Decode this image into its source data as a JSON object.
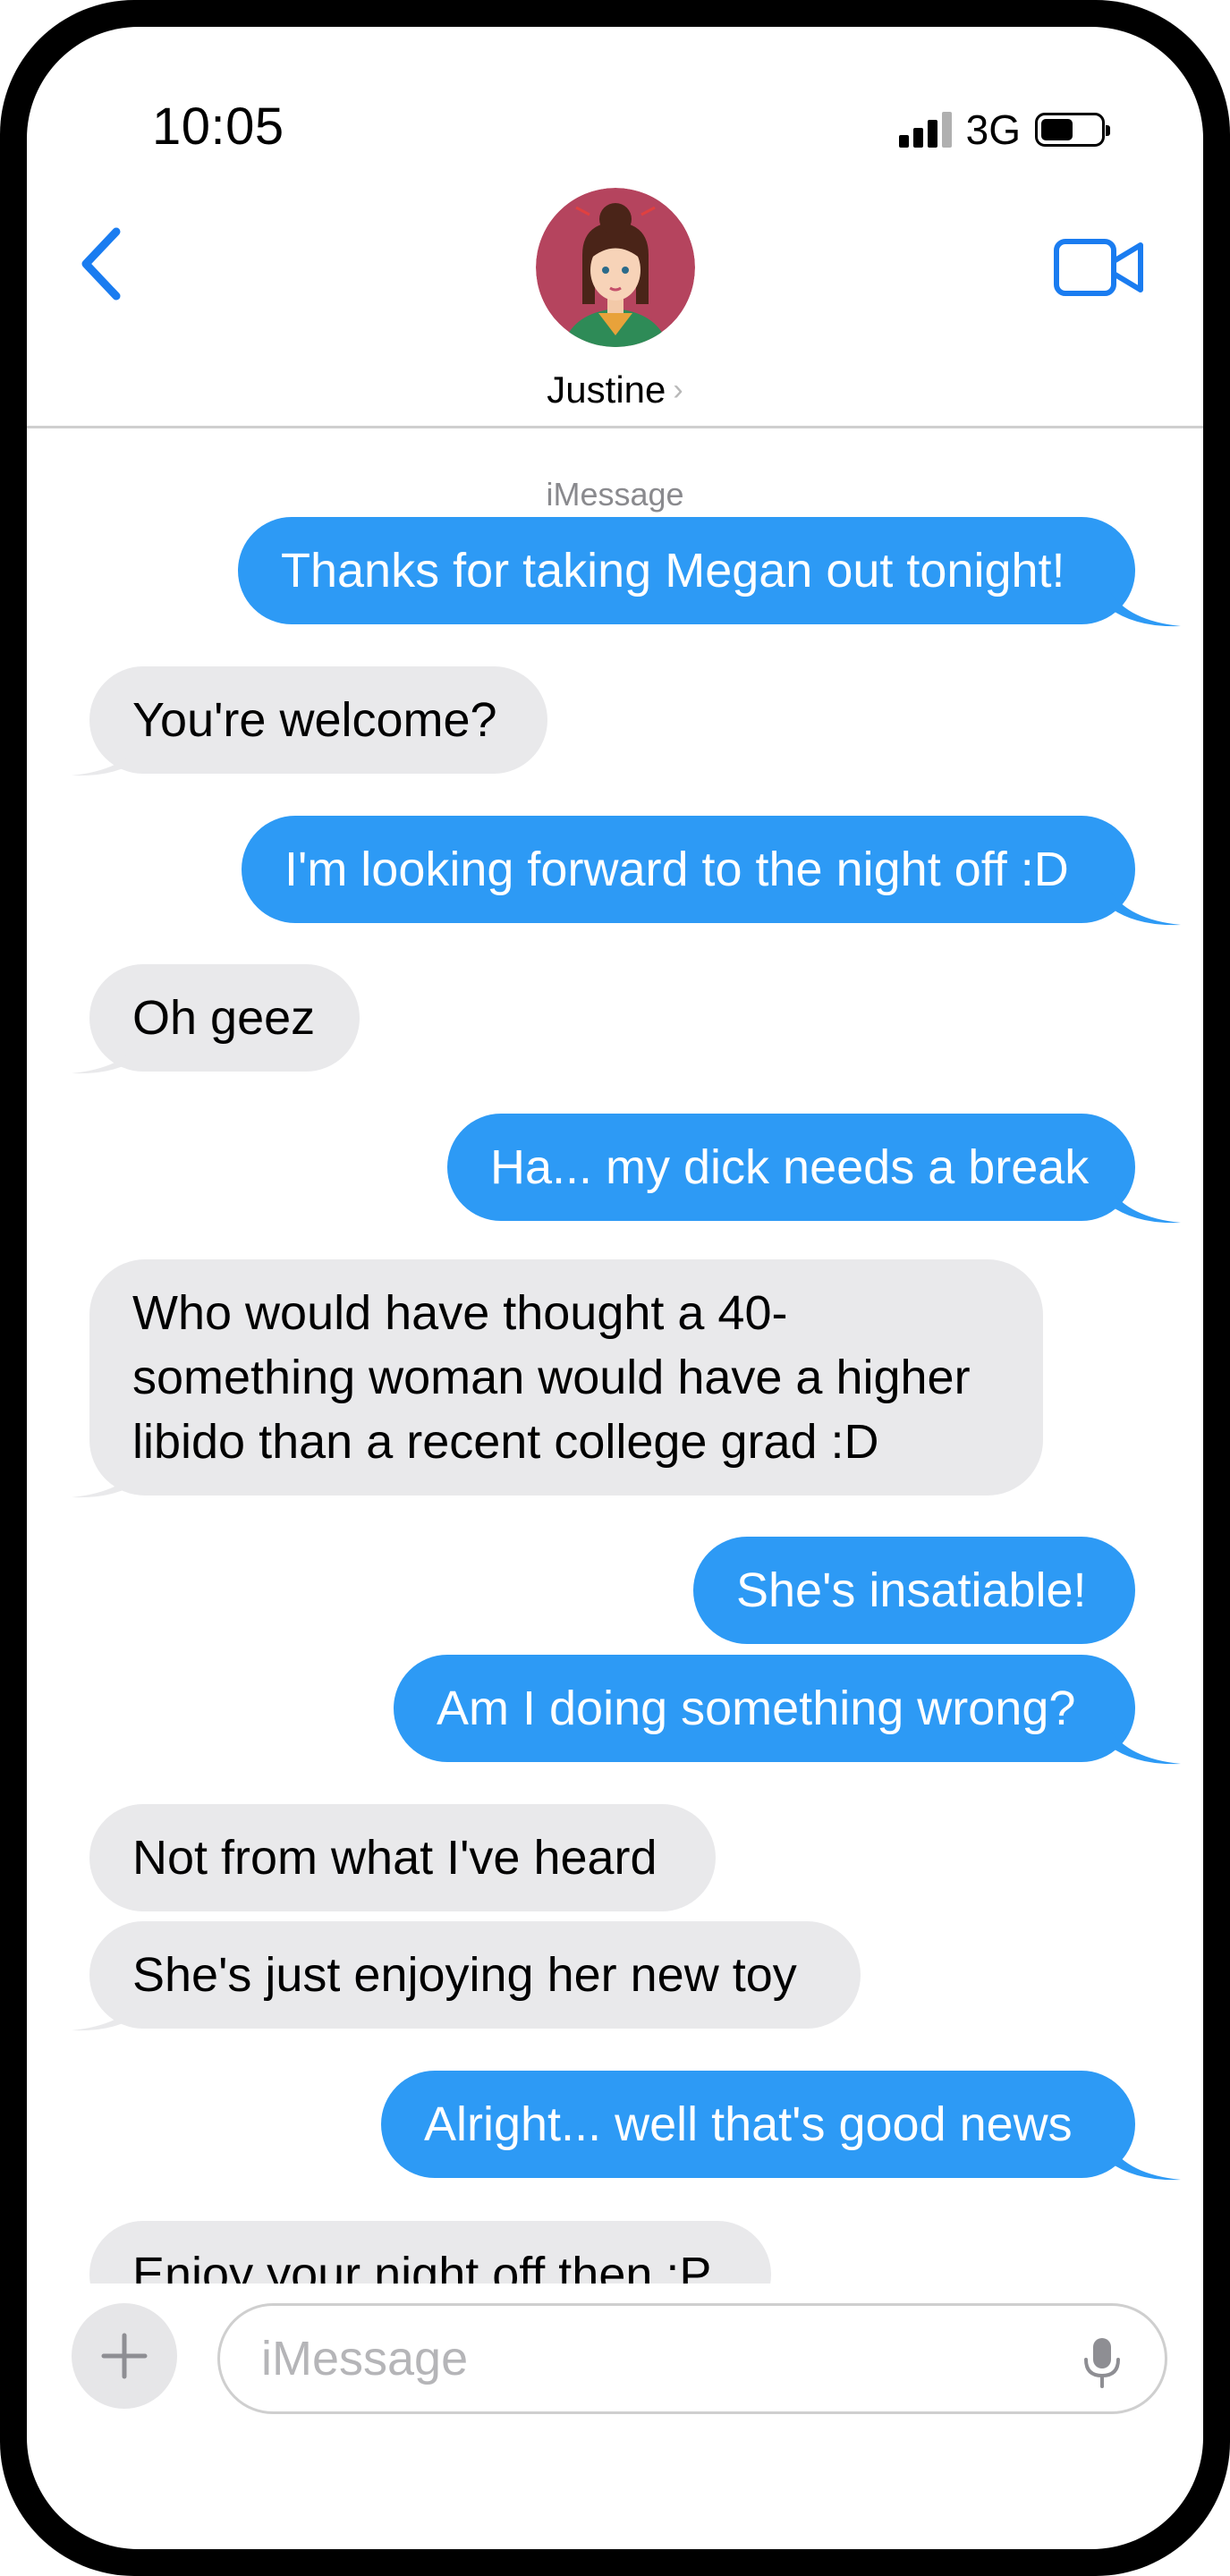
{
  "status_bar": {
    "time": "10:05",
    "network": "3G"
  },
  "header": {
    "contact_name": "Justine",
    "service_label": "iMessage"
  },
  "messages": [
    {
      "side": "sent",
      "text": "Thanks for taking Megan out tonight!"
    },
    {
      "side": "received",
      "text": "You're welcome?"
    },
    {
      "side": "sent",
      "text": "I'm looking forward to the night off :D"
    },
    {
      "side": "received",
      "text": "Oh geez"
    },
    {
      "side": "sent",
      "text": "Ha... my dick needs a break"
    },
    {
      "side": "received",
      "text": "Who would have thought a 40-something woman would have a higher libido than a recent college grad :D"
    },
    {
      "side": "sent",
      "text": "She's insatiable!"
    },
    {
      "side": "sent",
      "text": "Am I doing something wrong?"
    },
    {
      "side": "received",
      "text": "Not from what I've heard"
    },
    {
      "side": "received",
      "text": "She's just enjoying her new toy"
    },
    {
      "side": "sent",
      "text": "Alright... well that's good news"
    },
    {
      "side": "received",
      "text": "Enjoy your night off then :P"
    }
  ],
  "composer": {
    "placeholder": "iMessage"
  },
  "colors": {
    "sent_bubble": "#2d9af5",
    "received_bubble": "#e9e9eb",
    "accent": "#1a7cf0"
  },
  "icons": {
    "back": "chevron-left-icon",
    "video": "video-camera-icon",
    "add": "plus-icon",
    "mic": "microphone-icon"
  }
}
